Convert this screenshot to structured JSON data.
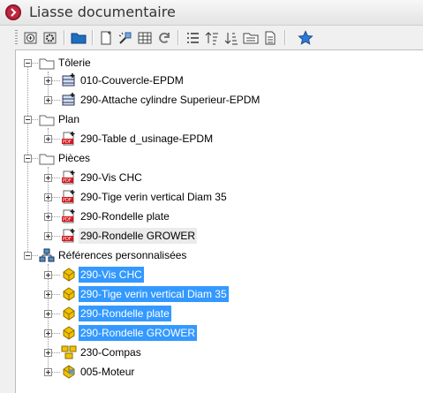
{
  "window": {
    "title": "Liasse documentaire"
  },
  "toolbar": {
    "buttons": [
      {
        "name": "add-document-button",
        "icon": "add-document-icon"
      },
      {
        "name": "settings-document-button",
        "icon": "gear-document-icon"
      },
      {
        "name": "folder-button",
        "icon": "blue-folder-icon"
      },
      {
        "name": "new-file-button",
        "icon": "new-file-icon"
      },
      {
        "name": "magic-tool-button",
        "icon": "wand-icon"
      },
      {
        "name": "table-button",
        "icon": "table-icon"
      },
      {
        "name": "refresh-button",
        "icon": "refresh-icon"
      },
      {
        "name": "list-button",
        "icon": "numbered-list-icon"
      },
      {
        "name": "sort-asc-button",
        "icon": "sort-asc-icon"
      },
      {
        "name": "sort-desc-button",
        "icon": "sort-desc-icon"
      },
      {
        "name": "folder-document-button",
        "icon": "folder-document-icon"
      },
      {
        "name": "document-button",
        "icon": "document-icon"
      },
      {
        "name": "favorite-button",
        "icon": "star-icon"
      }
    ]
  },
  "tree": {
    "groups": [
      {
        "label": "Tôlerie",
        "icon": "folder-icon",
        "items": [
          {
            "label": "010-Couvercle-EPDM",
            "icon": "sheet-metal-icon",
            "selected": false
          },
          {
            "label": "290-Attache cylindre Superieur-EPDM",
            "icon": "sheet-metal-icon",
            "selected": false
          }
        ]
      },
      {
        "label": "Plan",
        "icon": "folder-icon",
        "items": [
          {
            "label": "290-Table d_usinage-EPDM",
            "icon": "pdf-icon",
            "selected": false
          }
        ]
      },
      {
        "label": "Pièces",
        "icon": "folder-icon",
        "items": [
          {
            "label": "290-Vis CHC",
            "icon": "pdf-icon",
            "selected": false
          },
          {
            "label": "290-Tige verin vertical Diam 35",
            "icon": "pdf-icon",
            "selected": false
          },
          {
            "label": "290-Rondelle plate",
            "icon": "pdf-icon",
            "selected": false
          },
          {
            "label": "290-Rondelle GROWER",
            "icon": "pdf-icon",
            "selected": false
          }
        ]
      },
      {
        "label": "Références personnalisées",
        "icon": "hierarchy-icon",
        "items": [
          {
            "label": "290-Vis CHC",
            "icon": "part-icon",
            "selected": true
          },
          {
            "label": "290-Tige verin vertical Diam 35",
            "icon": "part-icon",
            "selected": true
          },
          {
            "label": "290-Rondelle plate",
            "icon": "part-icon",
            "selected": true
          },
          {
            "label": "290-Rondelle GROWER",
            "icon": "part-icon",
            "selected": true
          },
          {
            "label": "230-Compas",
            "icon": "assembly-icon",
            "selected": false
          },
          {
            "label": "005-Moteur",
            "icon": "cube-part-icon",
            "selected": false
          }
        ]
      }
    ]
  },
  "colors": {
    "selection": "#3399ff",
    "accent": "#c0283f"
  }
}
